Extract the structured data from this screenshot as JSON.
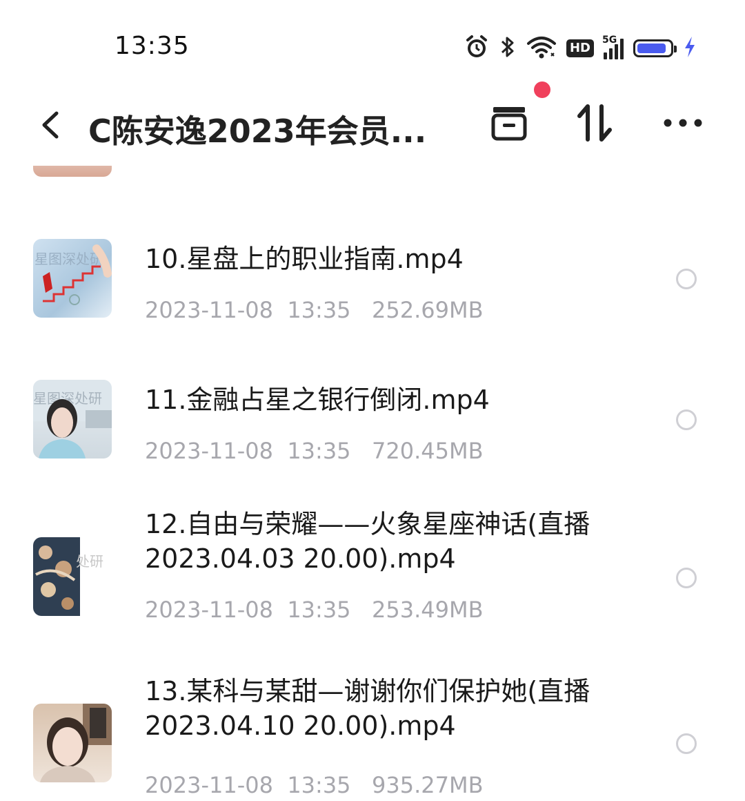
{
  "status_bar": {
    "time": "13:35",
    "icons": [
      "alarm-icon",
      "bluetooth-icon",
      "wifi-icon",
      "hd-badge",
      "5g-signal-icon",
      "battery-icon",
      "charging-icon"
    ],
    "hd_label": "HD",
    "network_label": "5G",
    "battery_level": 0.9,
    "battery_color": "#4a5bef"
  },
  "nav": {
    "title": "C陈安逸2023年会员...",
    "notification_dot_color": "#f0405c"
  },
  "files": [
    {
      "title": "10.星盘上的职业指南.mp4",
      "date": "2023-11-08",
      "time": "13:35",
      "size": "252.69MB",
      "thumb_text": "星图深处研"
    },
    {
      "title": "11.金融占星之银行倒闭.mp4",
      "date": "2023-11-08",
      "time": "13:35",
      "size": "720.45MB",
      "thumb_text": "星图深处研"
    },
    {
      "title": "12.自由与荣耀——火象星座神话(直播2023.04.03 20.00).mp4",
      "date": "2023-11-08",
      "time": "13:35",
      "size": "253.49MB",
      "thumb_text": "处研"
    },
    {
      "title": "13.某科与某甜—谢谢你们保护她(直播2023.04.10 20.00).mp4",
      "date": "2023-11-08",
      "time": "13:35",
      "size": "935.27MB",
      "thumb_text": ""
    }
  ]
}
